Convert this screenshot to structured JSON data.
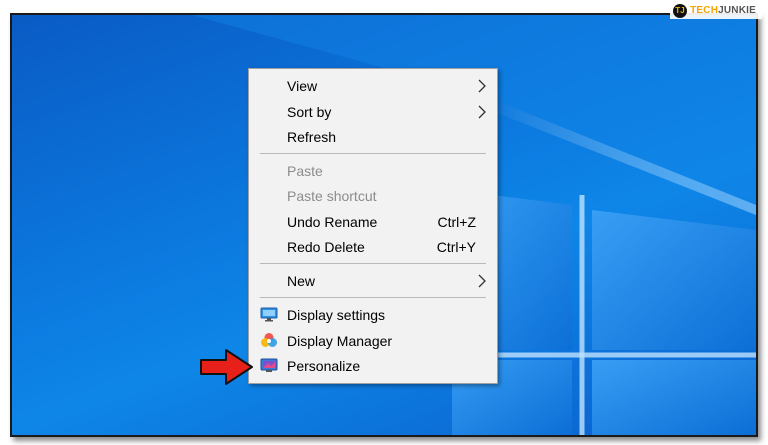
{
  "watermark": {
    "logo_letter": "TJ",
    "brand_part1": "TECH",
    "brand_part2": "JUNKIE"
  },
  "context_menu": {
    "items": [
      {
        "label": "View",
        "submenu": true
      },
      {
        "label": "Sort by",
        "submenu": true
      },
      {
        "label": "Refresh"
      },
      {
        "label": "Paste",
        "disabled": true
      },
      {
        "label": "Paste shortcut",
        "disabled": true
      },
      {
        "label": "Undo Rename",
        "shortcut": "Ctrl+Z"
      },
      {
        "label": "Redo Delete",
        "shortcut": "Ctrl+Y"
      },
      {
        "label": "New",
        "submenu": true
      },
      {
        "label": "Display settings",
        "icon": "display-settings-icon"
      },
      {
        "label": "Display Manager",
        "icon": "display-manager-icon"
      },
      {
        "label": "Personalize",
        "icon": "personalize-icon",
        "highlighted_by_annotation": true
      }
    ]
  },
  "colors": {
    "desktop_blue": "#0b74db",
    "menu_background": "#f2f2f2",
    "disabled_text": "#8c8c8c",
    "annotation_arrow": "#e8201a"
  }
}
